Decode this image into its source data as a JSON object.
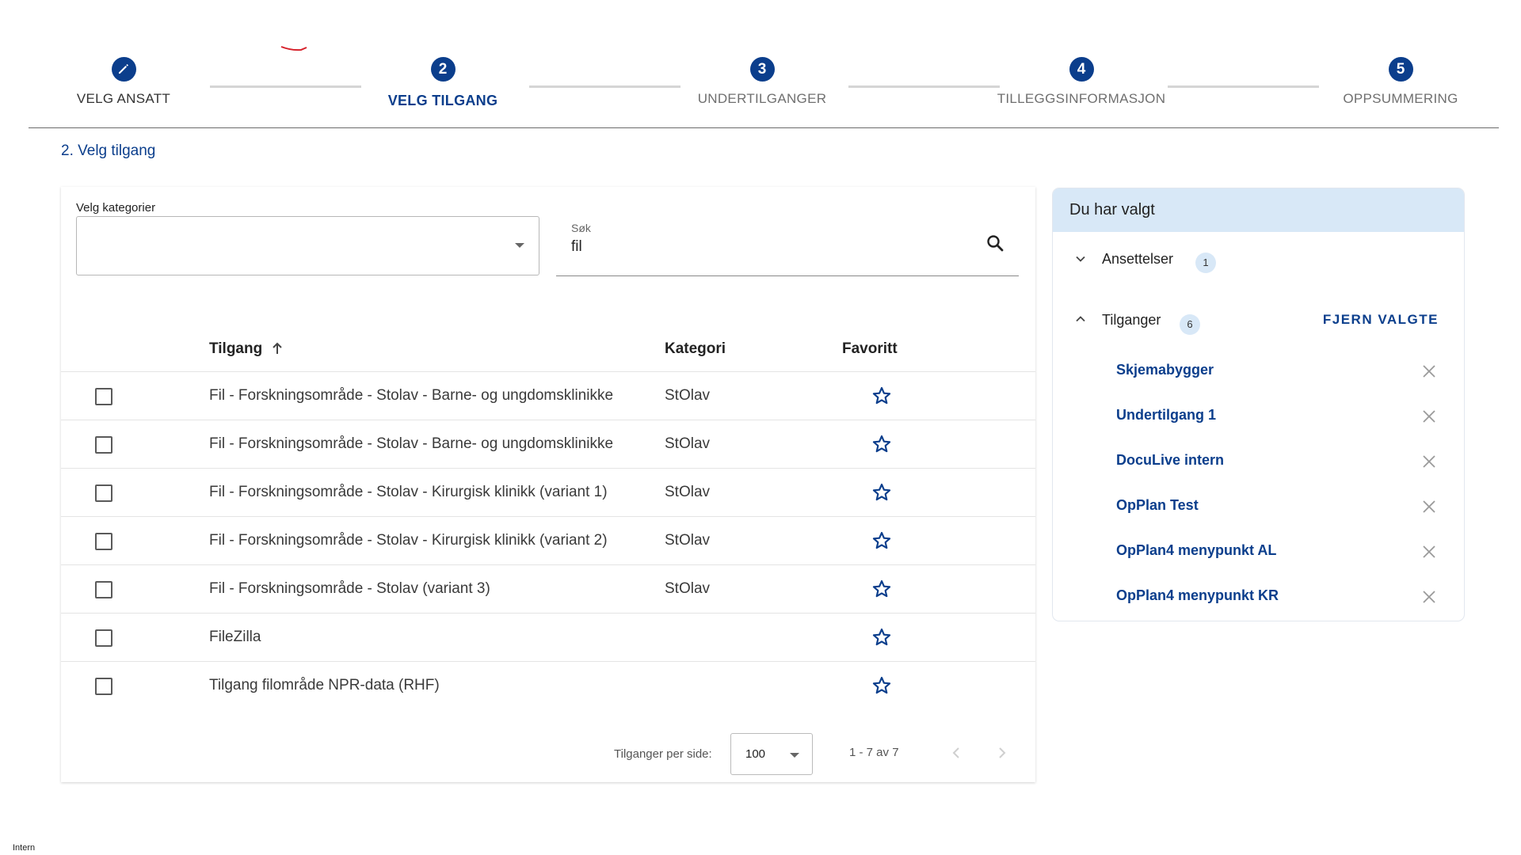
{
  "stepper": {
    "steps": [
      {
        "number": "",
        "label": "VELG ANSATT",
        "state": "done",
        "icon": "pencil-icon"
      },
      {
        "number": "2",
        "label": "VELG TILGANG",
        "state": "active"
      },
      {
        "number": "3",
        "label": "UNDERTILGANGER",
        "state": "pending"
      },
      {
        "number": "4",
        "label": "TILLEGGSINFORMASJON",
        "state": "pending"
      },
      {
        "number": "5",
        "label": "OPPSUMMERING",
        "state": "pending"
      }
    ]
  },
  "section_title": "2. Velg tilgang",
  "filters": {
    "category_label": "Velg kategorier",
    "category_value": "",
    "search_label": "Søk",
    "search_value": "fil"
  },
  "table": {
    "headers": {
      "name": "Tilgang",
      "category": "Kategori",
      "favorite": "Favoritt"
    },
    "sort": "ascending",
    "rows": [
      {
        "name": "Fil - Forskningsområde - Stolav - Barne- og ungdomsklinikke",
        "category": "StOlav",
        "checked": false,
        "favorite": false
      },
      {
        "name": "Fil - Forskningsområde - Stolav - Barne- og ungdomsklinikke",
        "category": "StOlav",
        "checked": false,
        "favorite": false
      },
      {
        "name": "Fil - Forskningsområde - Stolav - Kirurgisk klinikk (variant 1)",
        "category": "StOlav",
        "checked": false,
        "favorite": false
      },
      {
        "name": "Fil - Forskningsområde - Stolav - Kirurgisk klinikk (variant 2)",
        "category": "StOlav",
        "checked": false,
        "favorite": false
      },
      {
        "name": "Fil - Forskningsområde - Stolav (variant 3)",
        "category": "StOlav",
        "checked": false,
        "favorite": false
      },
      {
        "name": "FileZilla",
        "category": "",
        "checked": false,
        "favorite": false
      },
      {
        "name": "Tilgang filområde NPR-data (RHF)",
        "category": "",
        "checked": false,
        "favorite": false
      }
    ]
  },
  "pagination": {
    "per_page_label": "Tilganger per side:",
    "per_page_value": "100",
    "range_text": "1 - 7 av 7"
  },
  "selection_panel": {
    "title": "Du har valgt",
    "employments": {
      "label": "Ansettelser",
      "count": "1",
      "expanded": false
    },
    "accesses": {
      "label": "Tilganger",
      "count": "6",
      "expanded": true,
      "remove_all_label": "FJERN VALGTE",
      "items": [
        "Skjemabygger",
        "Undertilgang 1",
        "DocuLive intern",
        "OpPlan Test",
        "OpPlan4 menypunkt AL",
        "OpPlan4 menypunkt KR"
      ]
    }
  },
  "footer": {
    "classification": "Intern"
  },
  "colors": {
    "primary": "#0b3e8c",
    "panel_header": "#d8e8f7",
    "stepper_line": "#d5d5d5"
  }
}
